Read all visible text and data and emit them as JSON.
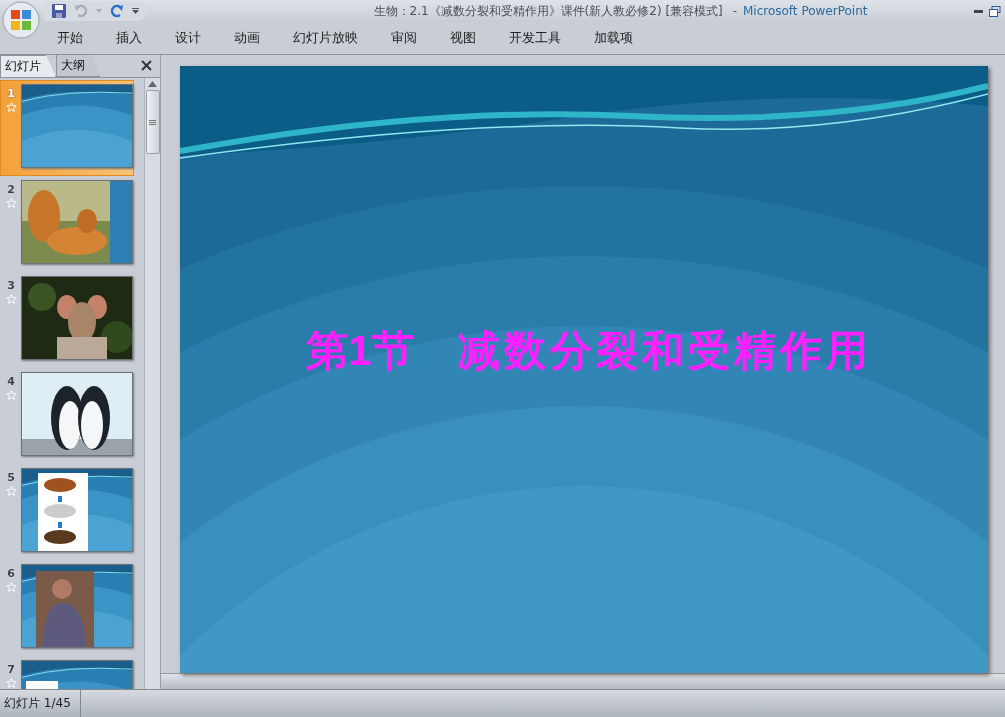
{
  "window": {
    "title": "生物：2.1《减数分裂和受精作用》课件(新人教必修2) [兼容模式]",
    "separator": "-",
    "app_name": "Microsoft PowerPoint"
  },
  "ribbon_tabs": [
    {
      "label": "开始"
    },
    {
      "label": "插入"
    },
    {
      "label": "设计"
    },
    {
      "label": "动画"
    },
    {
      "label": "幻灯片放映"
    },
    {
      "label": "审阅"
    },
    {
      "label": "视图"
    },
    {
      "label": "开发工具"
    },
    {
      "label": "加载项"
    }
  ],
  "panel_tabs": [
    {
      "label": "幻灯片",
      "selected": true
    },
    {
      "label": "大纲",
      "selected": false
    }
  ],
  "slides": [
    {
      "number": "1",
      "selected": true,
      "kind": "title"
    },
    {
      "number": "2",
      "selected": false,
      "kind": "tigers"
    },
    {
      "number": "3",
      "selected": false,
      "kind": "deer"
    },
    {
      "number": "4",
      "selected": false,
      "kind": "penguins"
    },
    {
      "number": "5",
      "selected": false,
      "kind": "horses"
    },
    {
      "number": "6",
      "selected": false,
      "kind": "person"
    },
    {
      "number": "7",
      "selected": false,
      "kind": "section"
    }
  ],
  "slide": {
    "title_number": "第1节",
    "title_text": "减数分裂和受精作用"
  },
  "status_bar": {
    "slide_indicator": "幻灯片 1/45"
  }
}
